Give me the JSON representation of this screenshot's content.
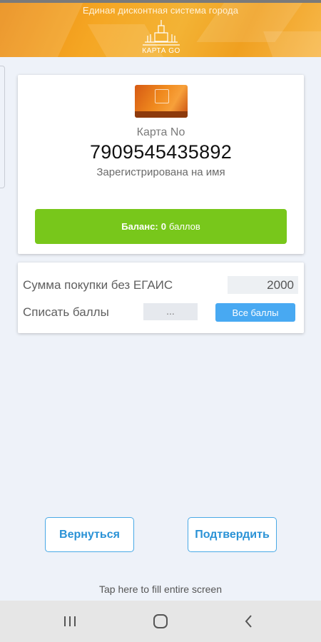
{
  "header": {
    "subtitle": "Единая дисконтная система города",
    "logo_text": "КАРТА GO",
    "colors": {
      "primary": "#f5a623",
      "accent": "#e98a12"
    }
  },
  "card": {
    "label": "Карта No",
    "number": "7909545435892",
    "owner_text": "Зарегистрирована на имя",
    "balance": {
      "prefix": "Баланс:",
      "value": "0",
      "unit": "баллов",
      "color": "#78c71b"
    },
    "image_icon": "discount-card-icon"
  },
  "form": {
    "sum_label": "Сумма покупки без ЕГАИС",
    "sum_value": "2000",
    "points_label": "Списать баллы",
    "points_value": "...",
    "all_points_label": "Все баллы",
    "all_points_color": "#48a9f2"
  },
  "actions": {
    "back_label": "Вернуться",
    "confirm_label": "Подтвердить",
    "color": "#2a92d6"
  },
  "hint": "Tap here to fill entire screen",
  "navbar": {
    "recents_icon": "recents-icon",
    "home_icon": "home-icon",
    "back_icon": "back-icon"
  }
}
